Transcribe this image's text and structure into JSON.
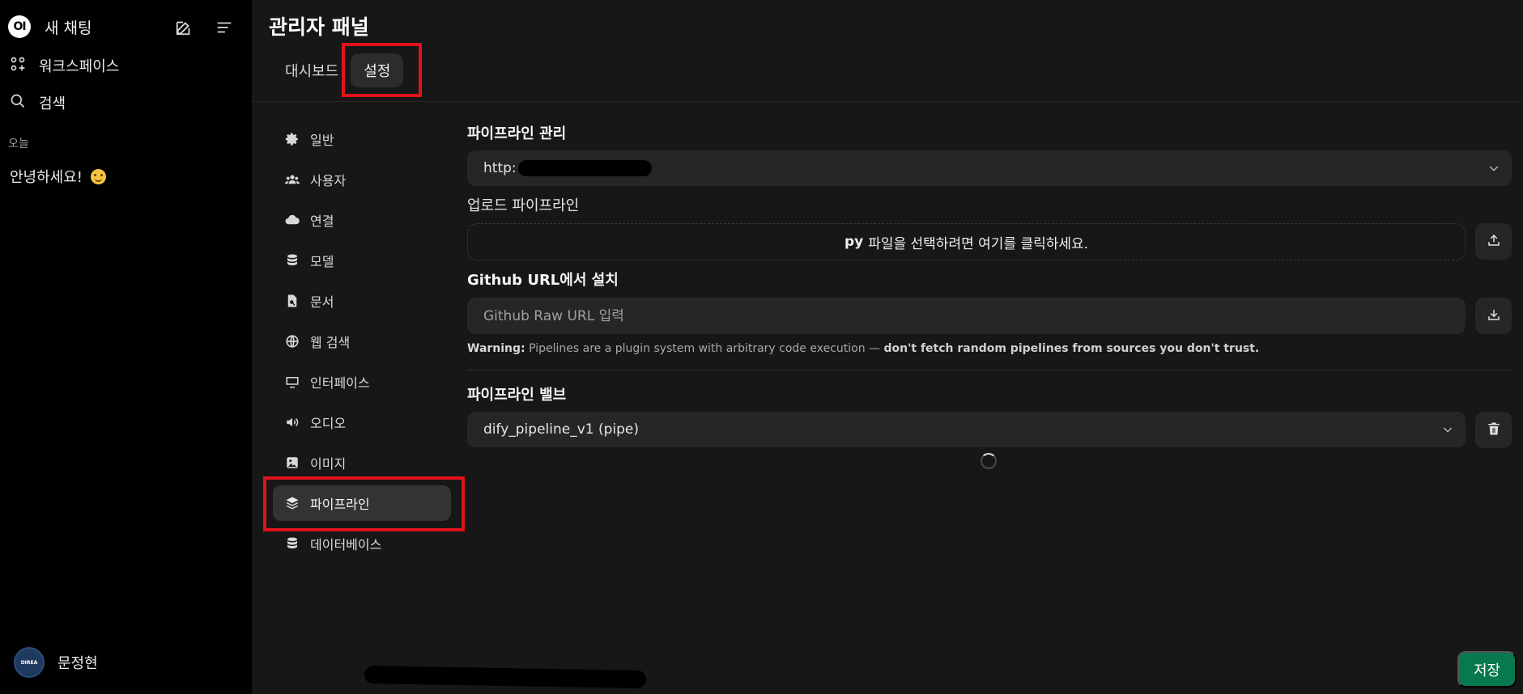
{
  "sidebar": {
    "logo_text": "OI",
    "new_chat_label": "새 채팅",
    "workspace_label": "워크스페이스",
    "search_label": "검색",
    "section_today": "오늘",
    "chats": [
      {
        "title": "안녕하세요!"
      }
    ],
    "user": {
      "name": "문정현",
      "avatar_text": "DIREA"
    }
  },
  "header": {
    "title": "관리자 패널",
    "tabs": [
      {
        "label": "대시보드",
        "active": false
      },
      {
        "label": "설정",
        "active": true
      }
    ]
  },
  "settings_nav": {
    "items": [
      {
        "label": "일반",
        "icon": "gear-icon"
      },
      {
        "label": "사용자",
        "icon": "users-icon"
      },
      {
        "label": "연결",
        "icon": "cloud-icon"
      },
      {
        "label": "모델",
        "icon": "database-icon"
      },
      {
        "label": "문서",
        "icon": "document-search-icon"
      },
      {
        "label": "웹 검색",
        "icon": "globe-icon"
      },
      {
        "label": "인터페이스",
        "icon": "monitor-icon"
      },
      {
        "label": "오디오",
        "icon": "speaker-icon"
      },
      {
        "label": "이미지",
        "icon": "image-icon"
      },
      {
        "label": "파이프라인",
        "icon": "layers-icon",
        "active": true
      },
      {
        "label": "데이터베이스",
        "icon": "database-icon"
      }
    ]
  },
  "pipelines": {
    "manage_title": "파이프라인 관리",
    "connection_value": "http:",
    "upload_title": "업로드 파이프라인",
    "upload_prompt_bold": "py",
    "upload_prompt": "파일을 선택하려면 여기를 클릭하세요.",
    "github_title": "Github URL에서 설치",
    "github_placeholder": "Github Raw URL 입력",
    "warning_label": "Warning:",
    "warning_text": "Pipelines are a plugin system with arbitrary code execution —",
    "warning_strong": "don't fetch random pipelines from sources you don't trust.",
    "valves_title": "파이프라인 밸브",
    "valves_selected": "dify_pipeline_v1 (pipe)"
  },
  "footer": {
    "save_label": "저장"
  },
  "colors": {
    "accent_save": "#08784e",
    "highlight": "#e0121a",
    "background": "#171717",
    "sidebar": "#000000"
  }
}
